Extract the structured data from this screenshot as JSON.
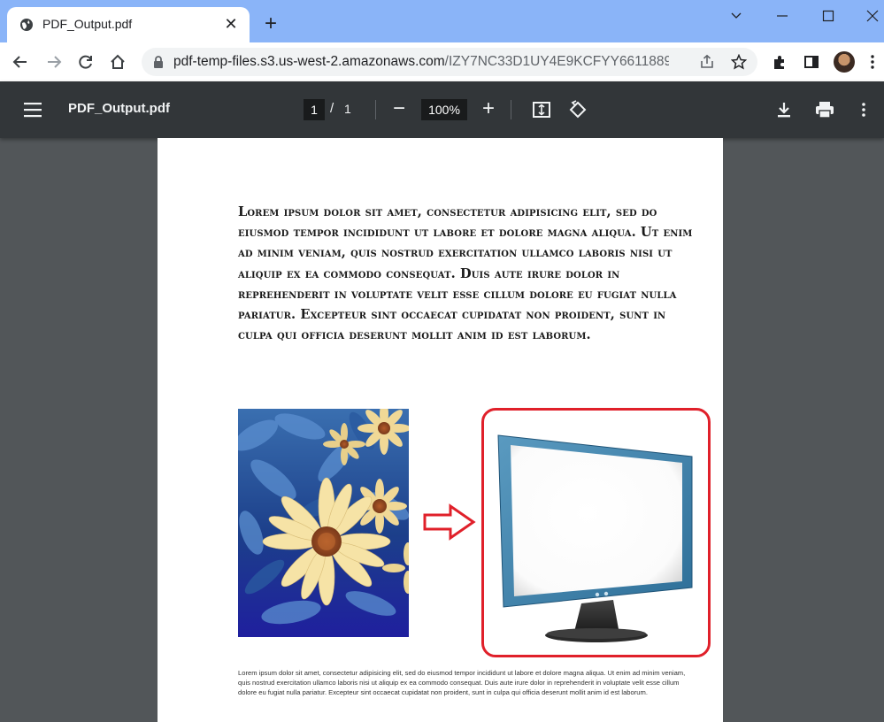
{
  "browser": {
    "tab_title": "PDF_Output.pdf",
    "url_host": "pdf-temp-files.s3.us-west-2.amazonaws.com",
    "url_path": "/IZY7NC33D1UY4E9KCFYY6611889I..."
  },
  "pdf_viewer": {
    "title": "PDF_Output.pdf",
    "current_page": "1",
    "page_separator": "/",
    "total_pages": "1",
    "zoom": "100%"
  },
  "document": {
    "heading_paragraph": "Lorem ipsum dolor sit amet, consectetur adipisicing elit, sed do eiusmod tempor incididunt ut labore et dolore magna aliqua. Ut enim ad minim veniam, quis nostrud exercitation ullamco laboris nisi ut aliquip ex ea commodo consequat. Duis aute irure dolor in reprehenderit in voluptate velit esse cillum dolore eu fugiat nulla pariatur. Excepteur sint occaecat cupidatat non proident, sunt in culpa qui officia deserunt mollit anim id est laborum.",
    "small_paragraph": "Lorem ipsum dolor sit amet, consectetur adipisicing elit, sed do eiusmod tempor incididunt ut labore et dolore magna aliqua. Ut enim ad minim veniam, quis nostrud exercitation ullamco laboris nisi ut aliquip ex ea commodo consequat. Duis aute irure dolor in reprehenderit in voluptate velit esse cillum dolore eu fugiat nulla pariatur. Excepteur sint occaecat cupidatat non proident, sunt in culpa qui officia deserunt mollit anim id est laborum."
  },
  "colors": {
    "tabstrip": "#8ab4f8",
    "pdf_toolbar": "#323639",
    "viewer_background": "#525659",
    "highlight": "#e0202a"
  },
  "icons": [
    "globe-icon",
    "close-icon",
    "plus-icon",
    "minimize-icon",
    "maximize-icon",
    "window-close-icon",
    "chevron-down-icon",
    "back-icon",
    "forward-icon",
    "reload-icon",
    "home-icon",
    "lock-icon",
    "share-icon",
    "star-icon",
    "extensions-icon",
    "side-panel-icon",
    "avatar",
    "more-icon",
    "menu-icon",
    "fit-page-icon",
    "rotate-icon",
    "download-icon",
    "print-icon"
  ]
}
